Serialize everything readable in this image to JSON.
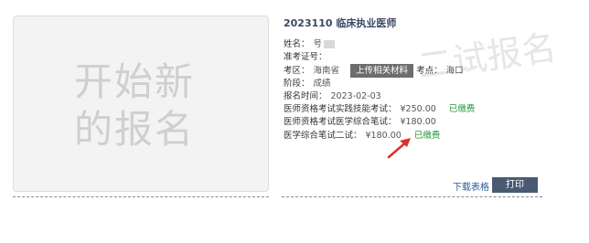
{
  "left_panel": {
    "text_line1": "开始新",
    "text_line2": "的报名"
  },
  "watermark": "二试报名",
  "exam": {
    "title": "2023110 临床执业医师",
    "name_label": "姓名：",
    "name_value": "号",
    "ticket_label": "准考证号：",
    "area_label": "考区：",
    "area_value": "海南省",
    "upload_label": "上传相关材料",
    "site_label": "考点：",
    "site_value": "海口",
    "stage_label": "阶段：",
    "stage_value": "成绩",
    "date_label": "报名时间：",
    "date_value": "2023-02-03",
    "fees": [
      {
        "label": "医师资格考试实践技能考试：",
        "amount": "¥250.00",
        "status": "已缴费"
      },
      {
        "label": "医师资格考试医学综合笔试：",
        "amount": "¥180.00",
        "status": ""
      },
      {
        "label": "医学综合笔试二试：",
        "amount": "¥180.00",
        "status": "已缴费"
      }
    ]
  },
  "actions": {
    "download": "下载表格",
    "print": "打印"
  },
  "colors": {
    "paid": "#1f9a3a",
    "print_button": "#4a5a72",
    "arrow": "#d9342b"
  }
}
